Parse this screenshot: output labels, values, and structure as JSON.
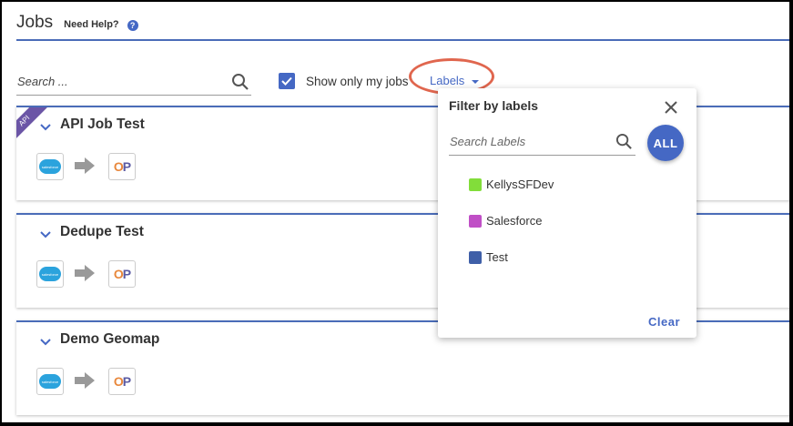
{
  "header": {
    "title": "Jobs",
    "help_text": "Need Help?",
    "help_icon": "?"
  },
  "toolbar": {
    "search_placeholder": "Search ...",
    "only_my_jobs_label": "Show only my jobs",
    "only_my_jobs_checked": true,
    "labels_button": "Labels"
  },
  "jobs": [
    {
      "name": "API Job Test",
      "badge": "API",
      "source": "salesforce",
      "target": "OP"
    },
    {
      "name": "Dedupe Test",
      "source": "salesforce",
      "target": "OP"
    },
    {
      "name": "Demo Geomap",
      "source": "salesforce",
      "target": "OP"
    }
  ],
  "label_filter": {
    "title": "Filter by labels",
    "search_placeholder": "Search Labels",
    "all_button": "ALL",
    "labels": [
      {
        "name": "KellysSFDev",
        "color": "#82dd3a"
      },
      {
        "name": "Salesforce",
        "color": "#c04fc6"
      },
      {
        "name": "Test",
        "color": "#3f5fa8"
      }
    ],
    "clear_button": "Clear"
  },
  "colors": {
    "accent": "#4568c4",
    "rule": "#4a6cb8",
    "highlight": "#e0664e"
  }
}
